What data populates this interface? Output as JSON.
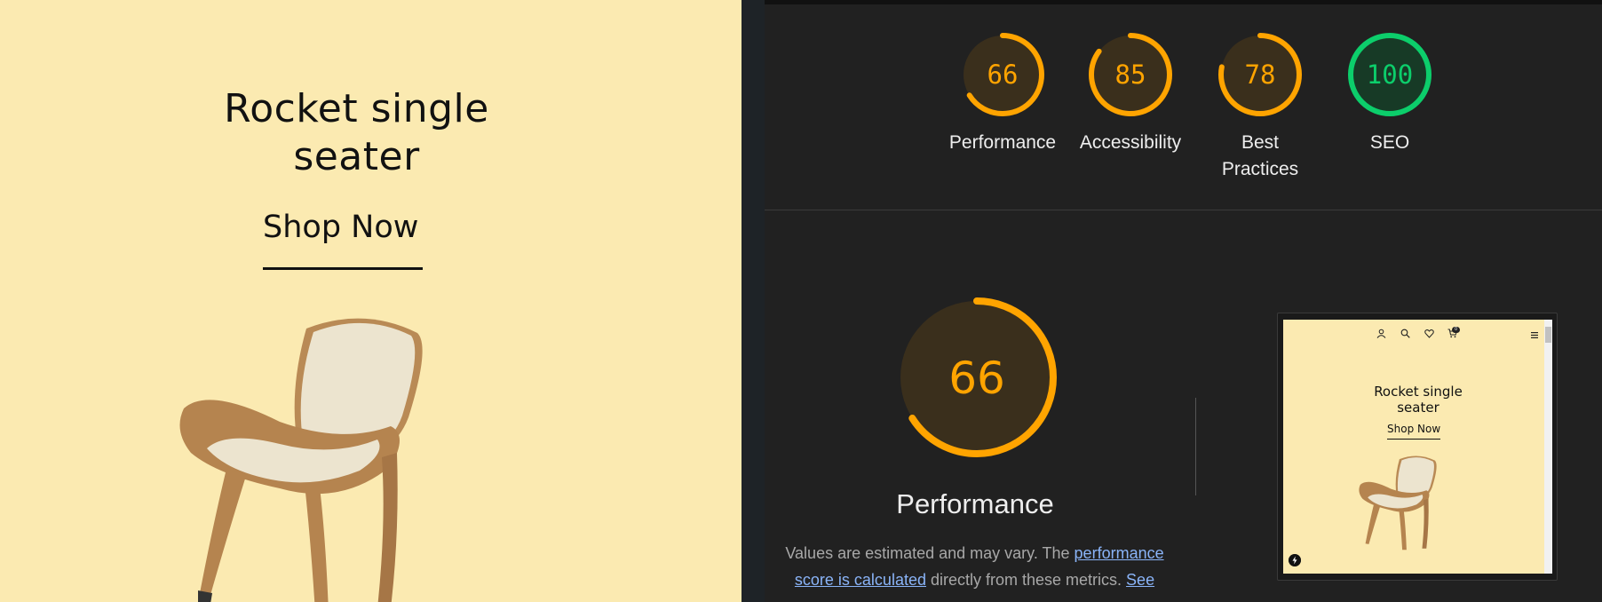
{
  "site": {
    "hero_title": "Rocket single seater",
    "shop_now": "Shop Now"
  },
  "scores": [
    {
      "label": "Performance",
      "value": "66",
      "fraction": 0.66,
      "color": "#ffa400"
    },
    {
      "label": "Accessibility",
      "value": "85",
      "fraction": 0.85,
      "color": "#ffa400"
    },
    {
      "label": "Best Practices",
      "value": "78",
      "fraction": 0.78,
      "color": "#ffa400"
    },
    {
      "label": "SEO",
      "value": "100",
      "fraction": 1.0,
      "color": "#0cce6b"
    }
  ],
  "performance": {
    "value": "66",
    "fraction": 0.66,
    "title": "Performance",
    "desc_text1": "Values are estimated and may vary. The ",
    "desc_link1": "performance score is calculated",
    "desc_text2": " directly from these metrics. ",
    "desc_link2": "See"
  },
  "thumbnail": {
    "title": "Rocket single seater",
    "shop_now": "Shop Now",
    "cart_count": "0"
  },
  "colors": {
    "orange": "#ffa400",
    "green": "#0cce6b",
    "page_bg": "#fbeab1",
    "report_bg": "#212121"
  }
}
